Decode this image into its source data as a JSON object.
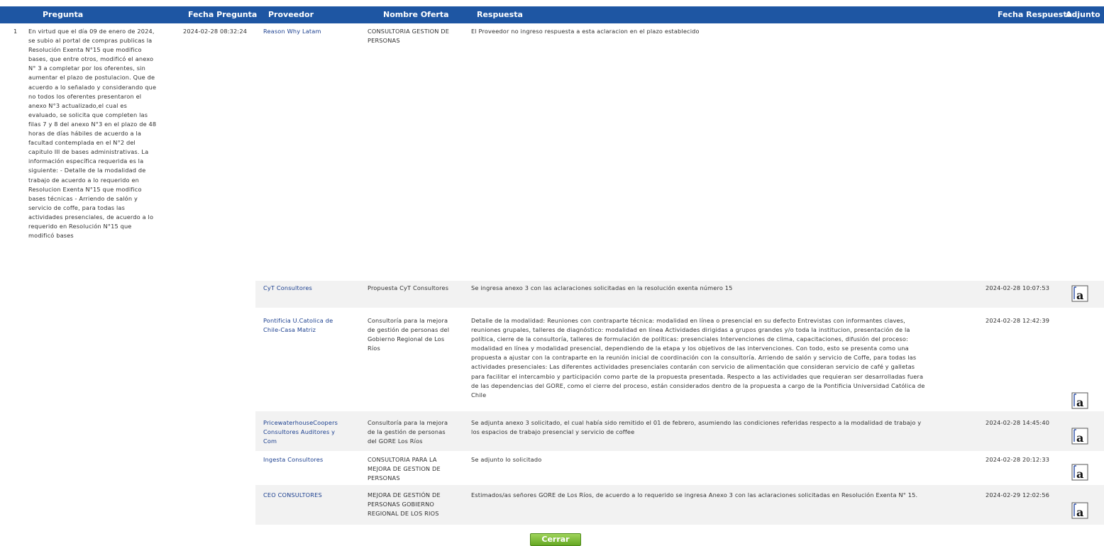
{
  "header": {
    "pregunta": "Pregunta",
    "fecha_pregunta": "Fecha Pregunta",
    "proveedor": "Proveedor",
    "nombre_oferta": "Nombre Oferta",
    "respuesta": "Respuesta",
    "fecha_respuesta": "Fecha Respuesta",
    "adjunto": "Adjunto"
  },
  "question": {
    "number": "1",
    "text": "En virtud que el día 09 de enero de 2024,\nse subio al portal de compras publicas la\nResolución Exenta N°15 que modifico\nbases, que entre otros, modificó el anexo\nN° 3 a completar por los oferentes, sin\naumentar el plazo de postulacion. Que de\nacuerdo a lo señalado y considerando que\nno todos los oferentes presentaron el\nanexo N°3 actualizado,el cual es\nevaluado, se solicita que completen las\nfilas 7 y 8 del anexo N°3 en el plazo de 48\nhoras de días hábiles de acuerdo a la\nfacultad contemplada en el N°2 del\ncapitulo III de bases administrativas. La\ninformación específica requerida es la\nsiguiente: - Detalle de la modalidad de\ntrabajo de acuerdo a lo requerido en\nResolucion Exenta N°15 que modifico\nbases técnicas - Arriendo de salón y\nservicio de coffe, para todas las\nactividades presenciales, de acuerdo a lo\nrequerido en Resolución N°15 que\nmodificó bases",
    "fecha": "2024-02-28 08:32:24"
  },
  "rows": [
    {
      "proveedor": "Reason Why Latam",
      "oferta": "CONSULTORIA GESTION DE\nPERSONAS",
      "respuesta": "El Proveedor no ingreso respuesta a esta aclaracion en el plazo establecido",
      "fecha": "",
      "adjunto": false
    },
    {
      "proveedor": "CyT Consultores",
      "oferta": "Propuesta CyT Consultores",
      "respuesta": "Se ingresa anexo 3 con las aclaraciones solicitadas en la resolución exenta número 15",
      "fecha": "2024-02-28 10:07:53",
      "adjunto": true
    },
    {
      "proveedor": "Pontificia U.Catolica de\nChile-Casa Matriz",
      "oferta": "Consultoría para la mejora\nde gestión de personas del\nGobierno Regional de Los\nRíos",
      "respuesta": "Detalle de la modalidad: Reuniones con contraparte técnica: modalidad en línea o presencial en su defecto Entrevistas con informantes claves,\nreuniones grupales, talleres de diagnóstico: modalidad en línea Actividades dirigidas a grupos grandes y/o toda la institucion, presentación de la\npolítica, cierre de la consultoría, talleres de formulación de políticas: presenciales Intervenciones de clima, capacitaciones, difusión del proceso:\nmodalidad en línea y modalidad presencial, dependiendo de la etapa y los objetivos de las intervenciones. Con todo, esto se presenta como una\npropuesta a ajustar con la contraparte en la reunión inicial de coordinación con la consultoría. Arriendo de salón y servicio de Coffe, para todas las\nactividades presenciales: Las diferentes actividades presenciales contarán con servicio de alimentación que consideran servicio de café y galletas\npara facilitar el intercambio y participación como parte de la propuesta presentada. Respecto a las actividades que requieran ser desarrolladas fuera\nde las dependencias del GORE, como el cierre del proceso, están considerados dentro de la propuesta a cargo de la Pontificia Universidad Católica de\nChile",
      "fecha": "2024-02-28 12:42:39",
      "adjunto": true
    },
    {
      "proveedor": "PricewaterhouseCoopers\nConsultores Auditores y\nCom",
      "oferta": "Consultoría para la mejora\nde la gestión de personas\ndel GORE Los Ríos",
      "respuesta": "Se adjunta anexo 3 solicitado, el cual había sido remitido el 01 de febrero, asumiendo las condiciones referidas respecto a la modalidad de trabajo y\nlos espacios de trabajo presencial y servicio de coffee",
      "fecha": "2024-02-28 14:45:40",
      "adjunto": true
    },
    {
      "proveedor": "Ingesta Consultores",
      "oferta": "CONSULTORIA PARA LA\nMEJORA DE GESTION DE\nPERSONAS",
      "respuesta": "Se adjunto lo solicitado",
      "fecha": "2024-02-28 20:12:33",
      "adjunto": true
    },
    {
      "proveedor": "CEO CONSULTORES",
      "oferta": "MEJORA DE GESTIÓN DE\nPERSONAS GOBIERNO\nREGIONAL DE LOS RIOS",
      "respuesta": "Estimados/as señores GORE de Los Ríos, de acuerdo a lo requerido se ingresa Anexo 3 con las aclaraciones solicitadas en Resolución Exenta N° 15.",
      "fecha": "2024-02-29 12:02:56",
      "adjunto": true
    }
  ],
  "close_button": "Cerrar",
  "icons": {
    "attachment": "text-document-icon"
  },
  "colors": {
    "header": "#1e56a3",
    "row_alt": "#f2f2f2",
    "link": "#1b3f8f",
    "button": "#66a824"
  }
}
